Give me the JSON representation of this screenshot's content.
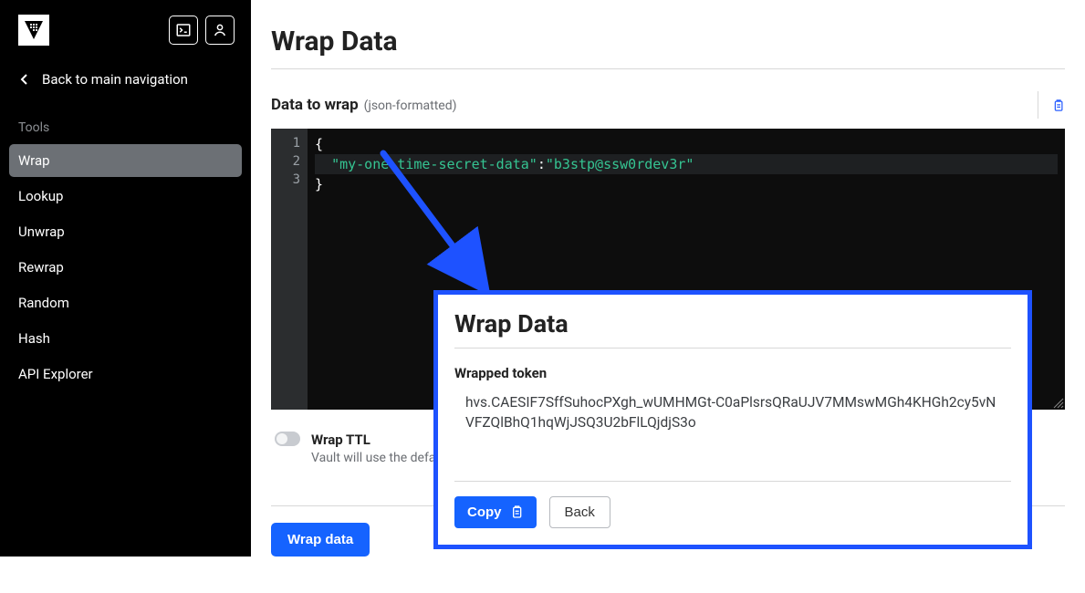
{
  "sidebar": {
    "back_label": "Back to main navigation",
    "section_label": "Tools",
    "items": [
      {
        "label": "Wrap",
        "active": true
      },
      {
        "label": "Lookup",
        "active": false
      },
      {
        "label": "Unwrap",
        "active": false
      },
      {
        "label": "Rewrap",
        "active": false
      },
      {
        "label": "Random",
        "active": false
      },
      {
        "label": "Hash",
        "active": false
      },
      {
        "label": "API Explorer",
        "active": false
      }
    ]
  },
  "main": {
    "title": "Wrap Data",
    "section_title": "Data to wrap",
    "section_hint": "(json-formatted)",
    "code": {
      "line1": "{",
      "line2_key": "\"my-one-time-secret-data\"",
      "line2_colon": ":",
      "line2_val": "\"b3stp@ssw0rdev3r\"",
      "line3": "}"
    },
    "ttl": {
      "label": "Wrap TTL",
      "hint": "Vault will use the defau"
    },
    "button": "Wrap data"
  },
  "overlay": {
    "title": "Wrap Data",
    "section_label": "Wrapped token",
    "token": "hvs.CAESIF7SffSuhocPXgh_wUMHMGt-C0aPlsrsQRaUJV7MMswMGh4KHGh2cy5vNVFZQlBhQ1hqWjJSQ3U2bFlLQjdjS3o",
    "copy_label": "Copy",
    "back_label": "Back"
  }
}
